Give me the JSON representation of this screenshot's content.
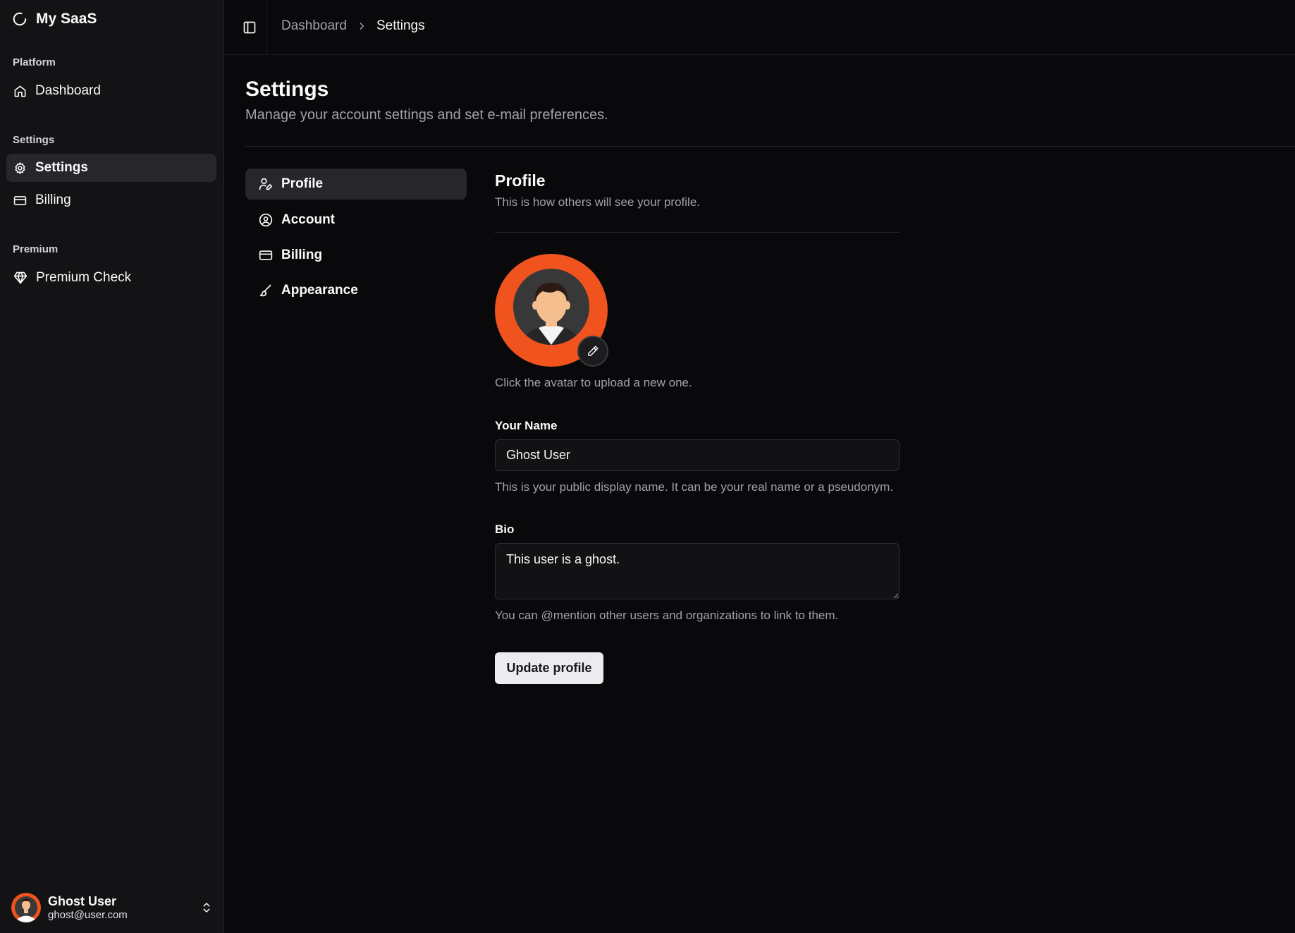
{
  "brand": {
    "name": "My SaaS",
    "icon": "loader-circle-icon"
  },
  "sidebar": {
    "groups": [
      {
        "label": "Platform",
        "items": [
          {
            "label": "Dashboard",
            "icon": "home-icon"
          }
        ]
      },
      {
        "label": "Settings",
        "items": [
          {
            "label": "Settings",
            "icon": "gear-icon",
            "active": true
          },
          {
            "label": "Billing",
            "icon": "credit-card-icon"
          }
        ]
      },
      {
        "label": "Premium",
        "items": [
          {
            "label": "Premium Check",
            "icon": "gem-icon"
          }
        ]
      }
    ],
    "user": {
      "name": "Ghost User",
      "email": "ghost@user.com"
    }
  },
  "breadcrumb": {
    "parent": "Dashboard",
    "current": "Settings"
  },
  "page": {
    "title": "Settings",
    "subtitle": "Manage your account settings and set e-mail preferences."
  },
  "subnav": [
    {
      "label": "Profile",
      "icon": "user-pen-icon",
      "active": true
    },
    {
      "label": "Account",
      "icon": "user-circle-icon"
    },
    {
      "label": "Billing",
      "icon": "credit-card-icon"
    },
    {
      "label": "Appearance",
      "icon": "brush-icon"
    }
  ],
  "profile": {
    "title": "Profile",
    "description": "This is how others will see your profile.",
    "avatar_hint": "Click the avatar to upload a new one.",
    "name_label": "Your Name",
    "name_value": "Ghost User",
    "name_help": "This is your public display name. It can be your real name or a pseudonym.",
    "bio_label": "Bio",
    "bio_value": "This user is a ghost.",
    "bio_help": "You can @mention other users and organizations to link to them.",
    "submit_label": "Update profile"
  },
  "colors": {
    "accent": "#f0531d",
    "background": "#09090b",
    "sidebar": "#131316",
    "active": "#27272b"
  }
}
